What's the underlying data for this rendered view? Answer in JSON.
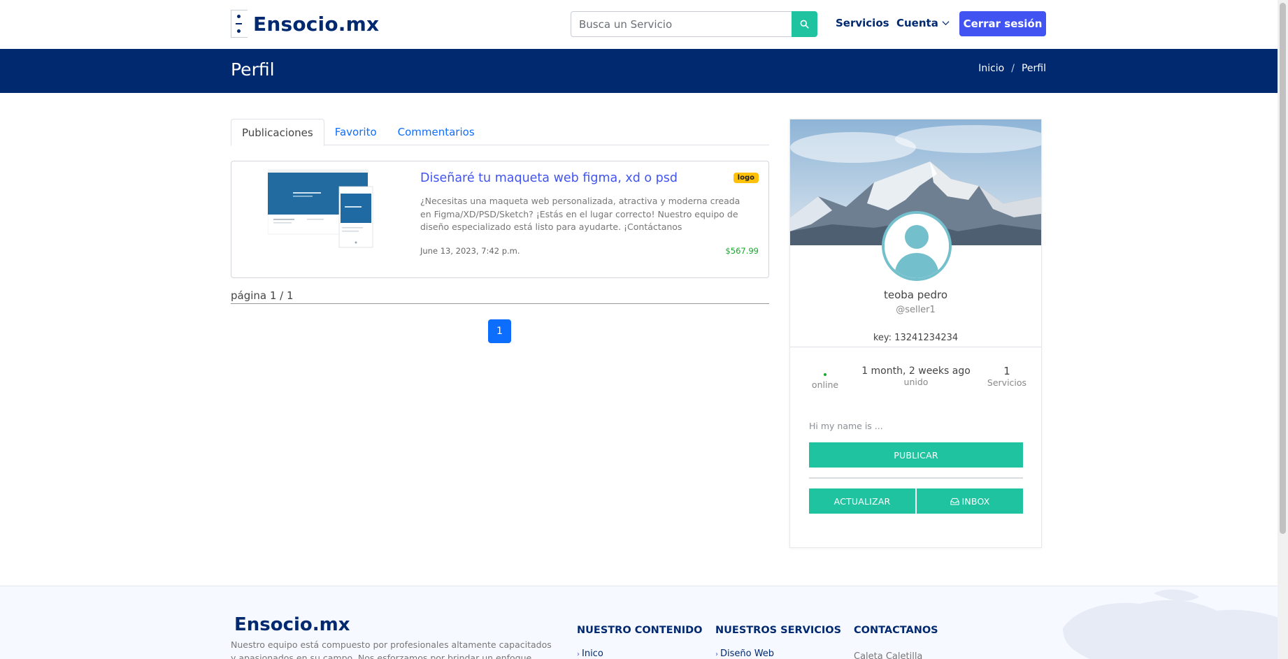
{
  "header": {
    "logo": "Ensocio.mx",
    "search_placeholder": "Busca un Servicio",
    "nav": {
      "servicios": "Servicios",
      "cuenta": "Cuenta",
      "logout": "Cerrar sesión"
    }
  },
  "band": {
    "title": "Perfil",
    "breadcrumb": [
      "Inicio",
      "/",
      "Perfil"
    ]
  },
  "tabs": [
    "Publicaciones",
    "Favorito",
    "Commentarios"
  ],
  "service": {
    "title": "Diseñaré tu maqueta web figma, xd o psd",
    "badge": "logo",
    "description": "¿Necesitas una maqueta web personalizada, atractiva y moderna creada en Figma/XD/PSD/Sketch? ¡Estás en el lugar correcto! Nuestro equipo de diseño especializado está listo para ayudarte. ¡Contáctanos",
    "date": "June 13, 2023, 7:42 p.m.",
    "price": "$567.99"
  },
  "pagination": {
    "info": "página 1 / 1",
    "current": "1"
  },
  "profile": {
    "name": "teoba pedro",
    "username": "@seller1",
    "key": "key: 13241234234",
    "stats": {
      "status_label": "online",
      "joined_value": "1 month, 2 weeks ago",
      "joined_label": "unido",
      "services_value": "1",
      "services_label": "Servicios"
    },
    "bio_placeholder": "Hi my name is ...",
    "publish": "PUBLICAR",
    "update": "ACTUALIZAR",
    "inbox": "INBOX"
  },
  "footer": {
    "logo": "Ensocio.mx",
    "about": "Nuestro equipo está compuesto por profesionales altamente capacitados y apasionados en su campo. Nos esforzamos por brindar un enfoque personalizado y",
    "columns": [
      {
        "heading": "NUESTRO CONTENIDO",
        "first_item": "Inico"
      },
      {
        "heading": "NUESTROS SERVICIOS",
        "first_item": "Diseño Web"
      },
      {
        "heading": "CONTACTANOS",
        "first_item": "Caleta Caletilla"
      }
    ]
  },
  "colors": {
    "navy": "#012970",
    "accent": "#4154f1",
    "teal": "#20c3a0",
    "primary": "#0d6efd",
    "price": "#17a82b",
    "badge": "#ffc107"
  }
}
